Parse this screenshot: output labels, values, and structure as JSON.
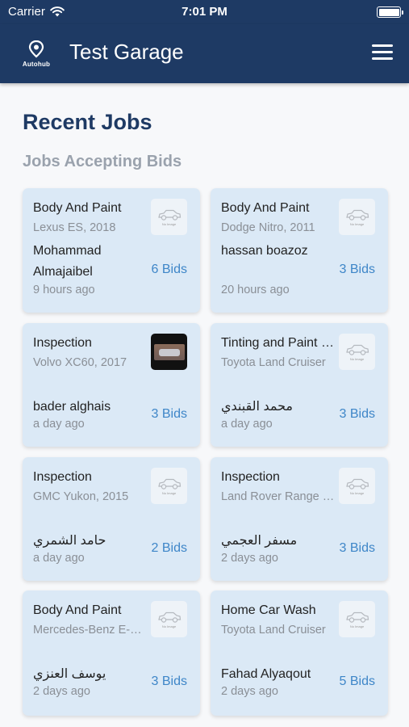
{
  "status": {
    "carrier": "Carrier",
    "time": "7:01 PM"
  },
  "nav": {
    "logo_text": "Autohub",
    "title": "Test Garage"
  },
  "page": {
    "title": "Recent Jobs",
    "section": "Jobs Accepting Bids"
  },
  "thumb_caption": "No Image",
  "jobs": [
    {
      "title": "Body And Paint",
      "car": "Lexus ES, 2018",
      "customer": "Mohammad Almajaibel",
      "time": "9 hours ago",
      "bids": "6 Bids",
      "image": "placeholder"
    },
    {
      "title": "Body And Paint",
      "car": "Dodge Nitro, 2011",
      "customer": "hassan boazoz",
      "time": "20 hours ago",
      "bids": "3 Bids",
      "image": "placeholder"
    },
    {
      "title": "Inspection",
      "car": "Volvo XC60, 2017",
      "customer": "bader alghais",
      "time": "a day ago",
      "bids": "3 Bids",
      "image": "photo"
    },
    {
      "title": "Tinting and Paint Protection",
      "car": "Toyota Land Cruiser",
      "customer": "محمد القبندي",
      "time": "a day ago",
      "bids": "3 Bids",
      "image": "placeholder"
    },
    {
      "title": "Inspection",
      "car": "GMC Yukon, 2015",
      "customer": "حامد الشمري",
      "time": "a day ago",
      "bids": "2 Bids",
      "image": "placeholder"
    },
    {
      "title": "Inspection",
      "car": "Land Rover Range Rover",
      "customer": "مسفر العجمي",
      "time": "2 days ago",
      "bids": "3 Bids",
      "image": "placeholder"
    },
    {
      "title": "Body And Paint",
      "car": "Mercedes-Benz E-Class",
      "customer": "يوسف العنزي",
      "time": "2 days ago",
      "bids": "3 Bids",
      "image": "placeholder"
    },
    {
      "title": "Home Car Wash",
      "car": "Toyota Land Cruiser",
      "customer": "Fahad Alyaqout",
      "time": "2 days ago",
      "bids": "5 Bids",
      "image": "placeholder"
    }
  ],
  "colors": {
    "header": "#1e3a64",
    "card": "#dbe9f6",
    "bids": "#3e86c8"
  },
  "icons": {
    "wifi": "wifi-icon",
    "battery": "battery-icon",
    "menu": "menu-icon",
    "logo": "location-pin-icon",
    "car": "car-icon"
  }
}
